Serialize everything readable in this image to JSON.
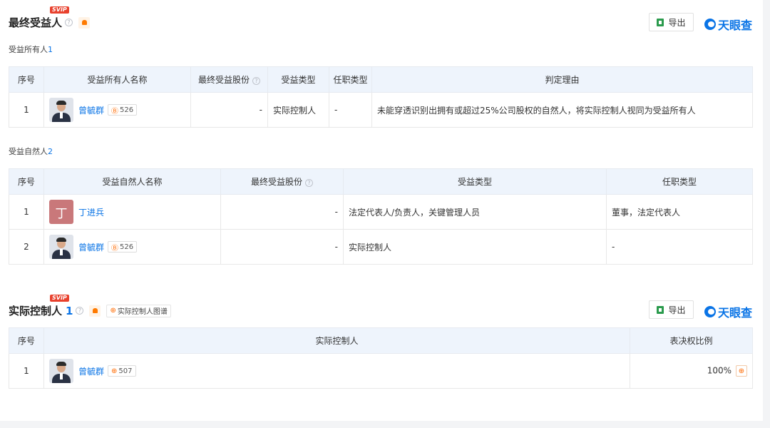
{
  "section1": {
    "title": "最终受益人",
    "svip": "SVIP",
    "export_label": "导出",
    "brand": "天眼查",
    "owners": {
      "label": "受益所有人",
      "count": "1",
      "headers": [
        "序号",
        "受益所有人名称",
        "最终受益股份",
        "受益类型",
        "任职类型",
        "判定理由"
      ],
      "rows": [
        {
          "index": "1",
          "name": "曾毓群",
          "badge": "526",
          "shares": "-",
          "type": "实际控制人",
          "position": "-",
          "reason": "未能穿透识别出拥有或超过25%公司股权的自然人，将实际控制人视同为受益所有人"
        }
      ]
    },
    "naturals": {
      "label": "受益自然人",
      "count": "2",
      "headers": [
        "序号",
        "受益自然人名称",
        "最终受益股份",
        "受益类型",
        "任职类型"
      ],
      "rows": [
        {
          "index": "1",
          "avatar_letter": "丁",
          "name": "丁进兵",
          "shares": "-",
          "type": "法定代表人/负责人，关键管理人员",
          "position": "董事，法定代表人"
        },
        {
          "index": "2",
          "name": "曾毓群",
          "badge": "526",
          "shares": "-",
          "type": "实际控制人",
          "position": "-"
        }
      ]
    }
  },
  "section2": {
    "title": "实际控制人",
    "count": "1",
    "svip": "SVIP",
    "chart_link": "实际控制人图谱",
    "export_label": "导出",
    "brand": "天眼查",
    "headers": [
      "序号",
      "实际控制人",
      "表决权比例"
    ],
    "rows": [
      {
        "index": "1",
        "name": "曾毓群",
        "badge": "507",
        "ratio": "100%"
      }
    ]
  },
  "colors": {
    "accent": "#0a74e6",
    "header_bg": "#eef4fc",
    "orange": "#ff6a00",
    "svip": "#e8412d"
  }
}
